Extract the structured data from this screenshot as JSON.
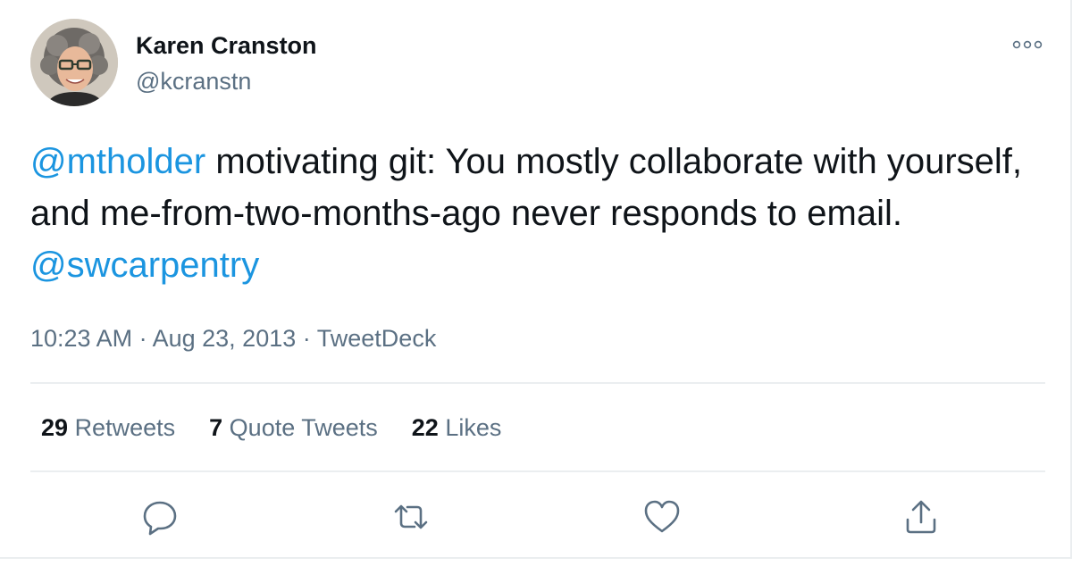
{
  "tweet": {
    "author": {
      "display_name": "Karen Cranston",
      "handle": "@kcranstn"
    },
    "text": {
      "mention_1": "@mtholder",
      "body": " motivating git: You mostly collaborate with yourself, and me-from-two-months-ago never responds to email. ",
      "mention_2": "@swcarpentry"
    },
    "time": "10:23 AM",
    "separator_1": " · ",
    "date": "Aug 23, 2013",
    "separator_2": " · ",
    "source": "TweetDeck",
    "stats": {
      "retweets_count": "29",
      "retweets_label": "Retweets",
      "quote_tweets_count": "7",
      "quote_tweets_label": "Quote Tweets",
      "likes_count": "22",
      "likes_label": "Likes"
    },
    "actions": [
      {
        "icon": "reply-icon"
      },
      {
        "icon": "retweet-icon"
      },
      {
        "icon": "heart-icon"
      },
      {
        "icon": "share-icon"
      }
    ],
    "colors": {
      "mention": "#1b95e0",
      "secondary_text": "#5b7083",
      "primary_text": "#0f1419",
      "divider": "#ebeef0"
    }
  }
}
